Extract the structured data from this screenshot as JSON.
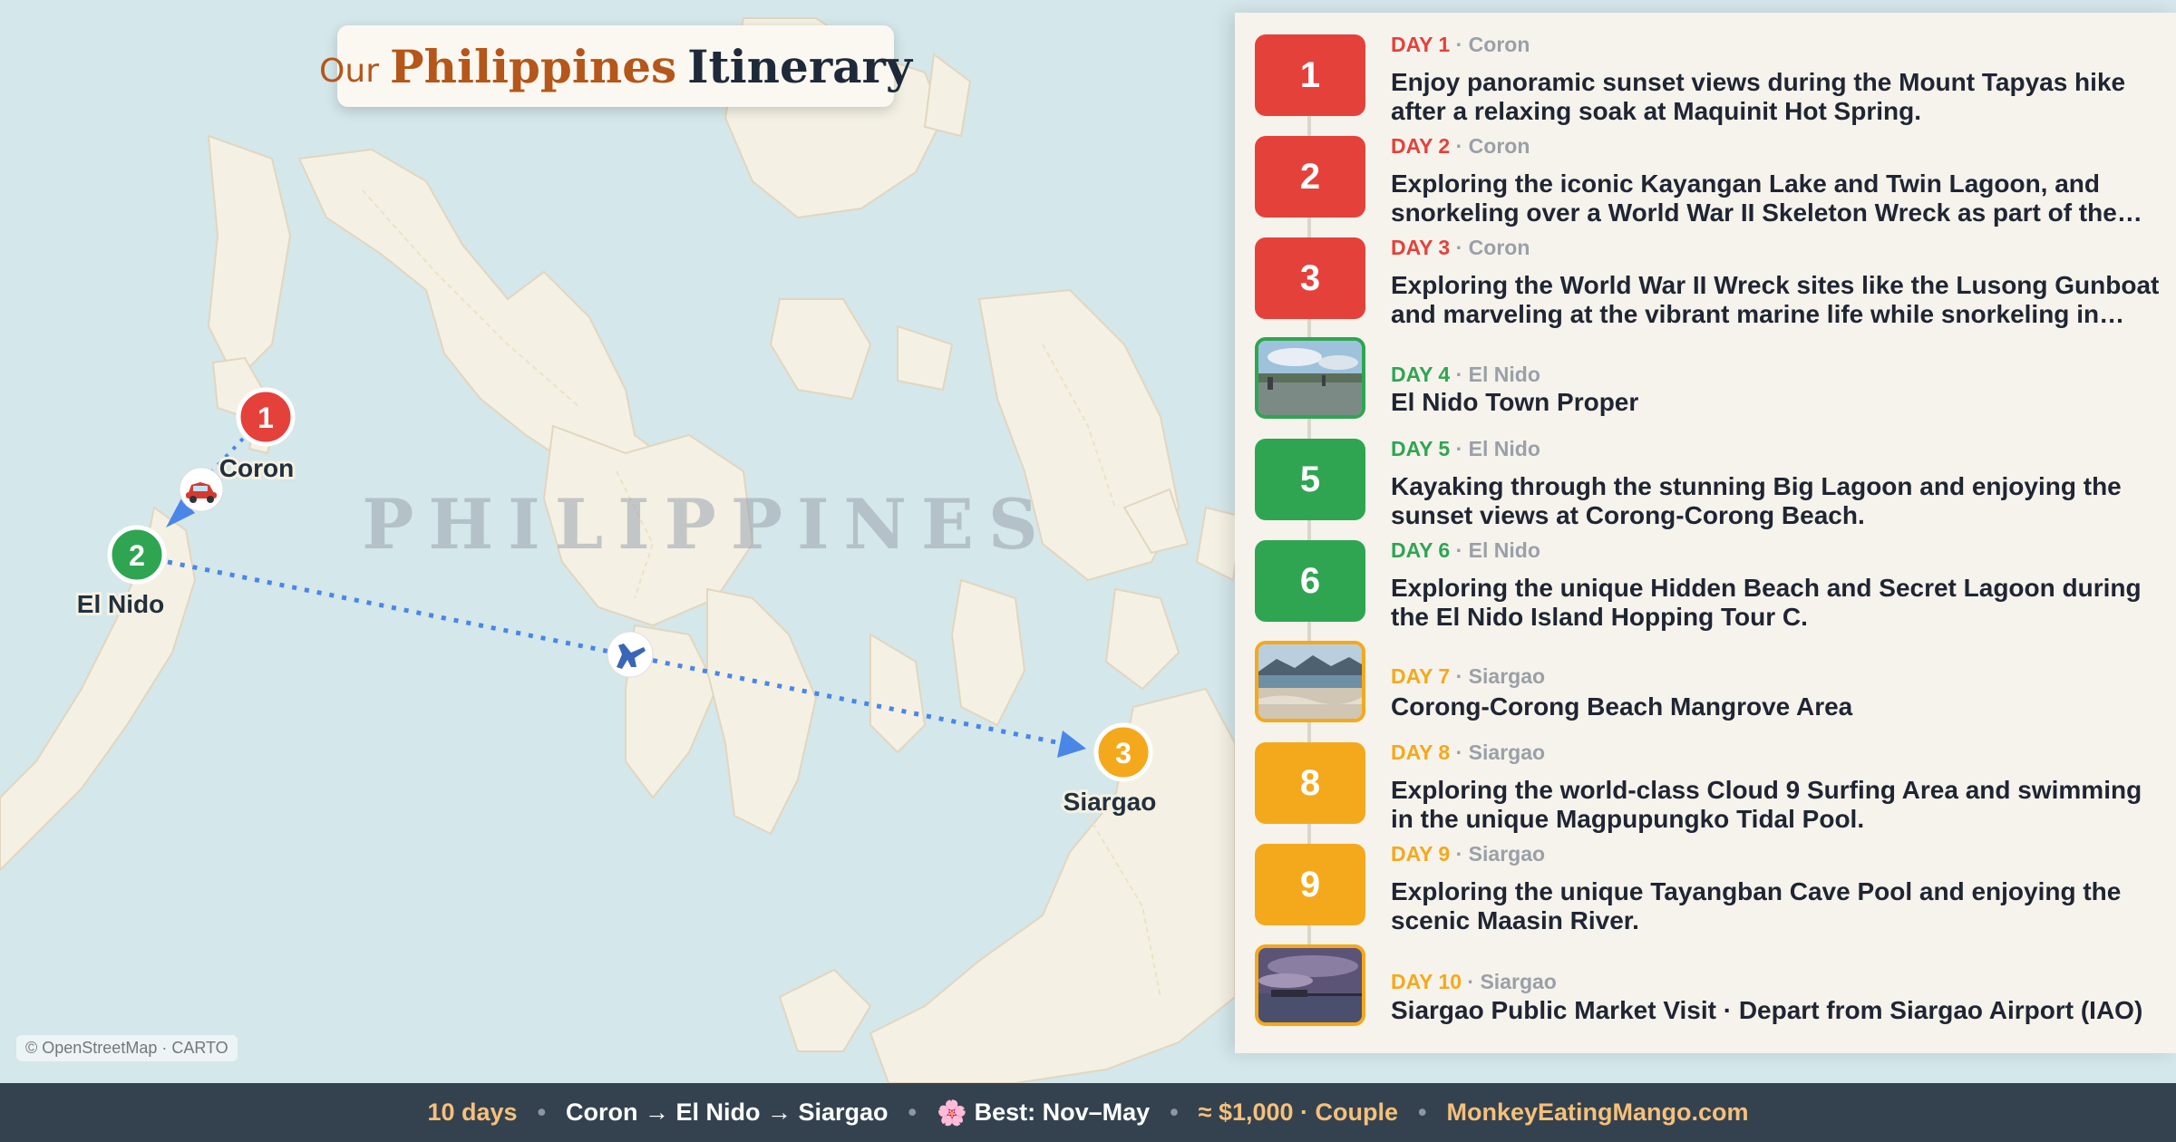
{
  "title": {
    "prefix": "Our",
    "main": "Philippines",
    "suffix": "Itinerary"
  },
  "map": {
    "country_label": "PHILIPPINES",
    "attribution": "© OpenStreetMap · CARTO",
    "stops": [
      {
        "number": "1",
        "name": "Coron",
        "color": "#e5413b"
      },
      {
        "number": "2",
        "name": "El Nido",
        "color": "#2fa552"
      },
      {
        "number": "3",
        "name": "Siargao",
        "color": "#f4a91c"
      }
    ],
    "legs": [
      {
        "from": "Coron",
        "to": "El Nido",
        "mode_icon": "car-icon"
      },
      {
        "from": "El Nido",
        "to": "Siargao",
        "mode_icon": "airplane-icon"
      }
    ]
  },
  "days": [
    {
      "label": "DAY 1",
      "location": "Coron",
      "number": "1",
      "title": "Enjoy panoramic sunset views during the Mount Tapyas hike after a relaxing soak at Maquinit Hot Spring.",
      "color": "#e5413b"
    },
    {
      "label": "DAY 2",
      "location": "Coron",
      "number": "2",
      "title": "Exploring the iconic Kayangan Lake and Twin Lagoon, and snorkeling over a World War II Skeleton Wreck as part of the Coron Island Tour.",
      "color": "#e5413b"
    },
    {
      "label": "DAY 3",
      "location": "Coron",
      "number": "3",
      "title": "Exploring the World War II Wreck sites like the Lusong Gunboat and marveling at the vibrant marine life while snorkeling in Coron Bay.",
      "color": "#e5413b"
    },
    {
      "label": "DAY 4",
      "location": "El Nido",
      "number": "4",
      "title": "El Nido Town Proper",
      "color": "#2fa552",
      "photo": "town-photo"
    },
    {
      "label": "DAY 5",
      "location": "El Nido",
      "number": "5",
      "title": "Kayaking through the stunning Big Lagoon and enjoying the sunset views at Corong-Corong Beach.",
      "color": "#2fa552"
    },
    {
      "label": "DAY 6",
      "location": "El Nido",
      "number": "6",
      "title": "Exploring the unique Hidden Beach and Secret Lagoon during the El Nido Island Hopping Tour C.",
      "color": "#2fa552"
    },
    {
      "label": "DAY 7",
      "location": "Siargao",
      "number": "7",
      "title": "Corong-Corong Beach Mangrove Area",
      "color": "#f4a91c",
      "photo": "beach-photo"
    },
    {
      "label": "DAY 8",
      "location": "Siargao",
      "number": "8",
      "title": "Exploring the world-class Cloud 9 Surfing Area and swimming in the unique Magpupungko Tidal Pool.",
      "color": "#f4a91c"
    },
    {
      "label": "DAY 9",
      "location": "Siargao",
      "number": "9",
      "title": "Exploring the unique Tayangban Cave Pool and enjoying the scenic Maasin River.",
      "color": "#f4a91c"
    },
    {
      "label": "DAY 10",
      "location": "Siargao",
      "number": "10",
      "title": "Siargao Public Market Visit · Depart from Siargao Airport (IAO)",
      "color": "#f4a91c",
      "photo": "pier-photo"
    }
  ],
  "footer": {
    "days": "10 days",
    "route": "Coron → El Nido → Siargao",
    "season_icon": "🌸",
    "season": "Best: Nov–May",
    "budget": "≈ $1,000 · Couple",
    "site": "MonkeyEatingMango.com"
  }
}
